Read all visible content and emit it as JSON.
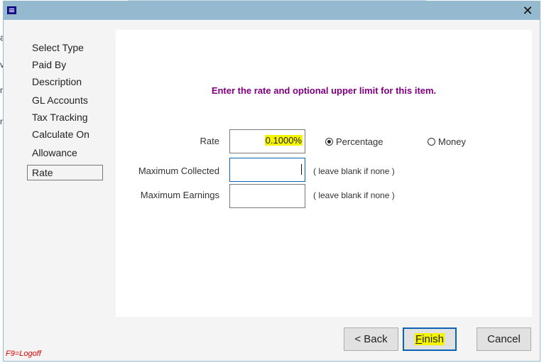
{
  "window": {
    "close_icon": "✕",
    "app_icon": "app-window-icon"
  },
  "sidebar": {
    "items": [
      {
        "label": "Select Type"
      },
      {
        "label": "Paid By"
      },
      {
        "label": "Description"
      },
      {
        "label": "GL Accounts"
      },
      {
        "label": "Tax Tracking"
      },
      {
        "label": "Calculate On"
      },
      {
        "label": "Allowance"
      },
      {
        "label": "Rate",
        "active": true
      }
    ]
  },
  "main": {
    "instruction": "Enter the rate and optional upper limit for this item.",
    "rate": {
      "label": "Rate",
      "value": "0.1000%"
    },
    "rate_type": {
      "options": [
        {
          "label": "Percentage",
          "checked": true
        },
        {
          "label": "Money",
          "checked": false
        }
      ]
    },
    "max_collected": {
      "label": "Maximum Collected",
      "value": "",
      "hint": "( leave blank if none )"
    },
    "max_earnings": {
      "label": "Maximum Earnings",
      "value": "",
      "hint": "( leave blank if none )"
    }
  },
  "buttons": {
    "back": "< Back",
    "finish_mnemonic": "F",
    "finish_rest": "inish",
    "cancel": "Cancel"
  },
  "footer": {
    "logoff_hint": "F9=Logoff"
  }
}
